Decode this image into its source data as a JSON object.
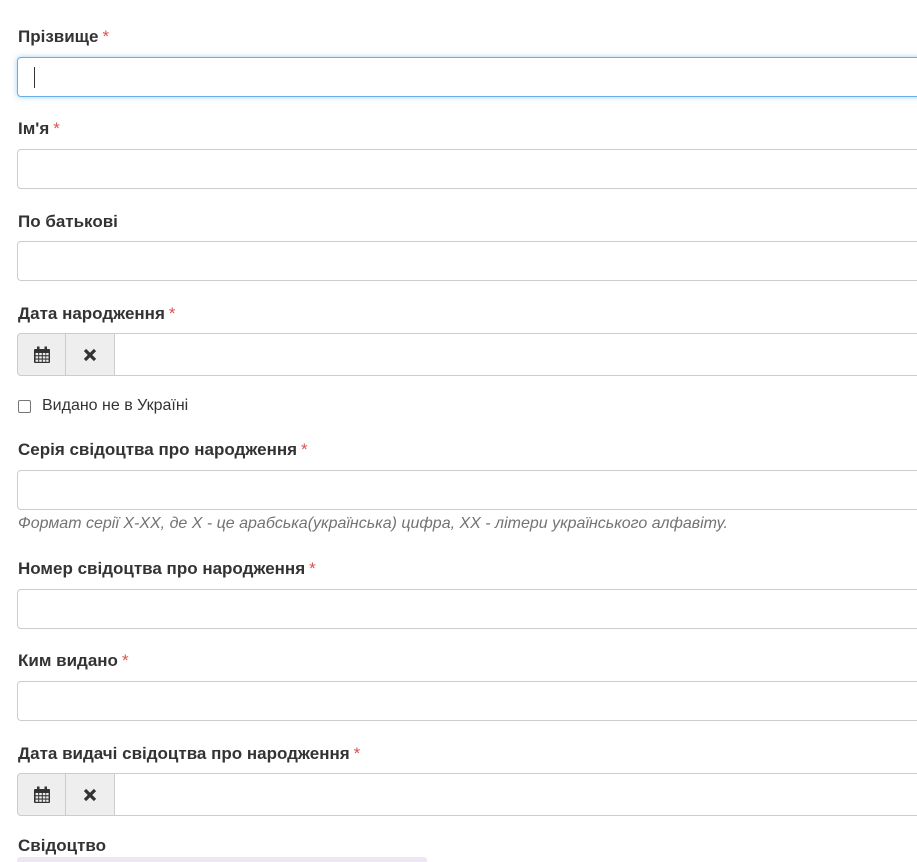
{
  "fields": {
    "surname": {
      "label": "Прізвище",
      "required_mark": "*",
      "value": ""
    },
    "first_name": {
      "label": "Ім'я",
      "required_mark": "*",
      "value": ""
    },
    "patronymic": {
      "label": "По батькові",
      "value": ""
    },
    "birth_date": {
      "label": "Дата народження",
      "required_mark": "*",
      "value": ""
    },
    "issued_abroad": {
      "label": "Видано не в Україні",
      "checked": false
    },
    "certificate_series": {
      "label": "Серія свідоцтва про народження",
      "required_mark": "*",
      "value": "",
      "help": "Формат серії Х-ХХ, де Х - це арабська(українська) цифра, ХХ - літери українського алфавіту."
    },
    "certificate_number": {
      "label": "Номер свідоцтва про народження",
      "required_mark": "*",
      "value": ""
    },
    "issued_by": {
      "label": "Ким видано",
      "required_mark": "*",
      "value": ""
    },
    "issue_date": {
      "label": "Дата видачі свідоцтва про народження",
      "required_mark": "*",
      "value": ""
    },
    "certificate": {
      "label": "Свідоцтво"
    }
  },
  "icons": {
    "calendar": "calendar-icon",
    "clear": "close-icon"
  },
  "colors": {
    "required": "#d9534f",
    "focus_border": "#66afe9",
    "addon_bg": "#eeeeee",
    "help_text": "#737373"
  }
}
